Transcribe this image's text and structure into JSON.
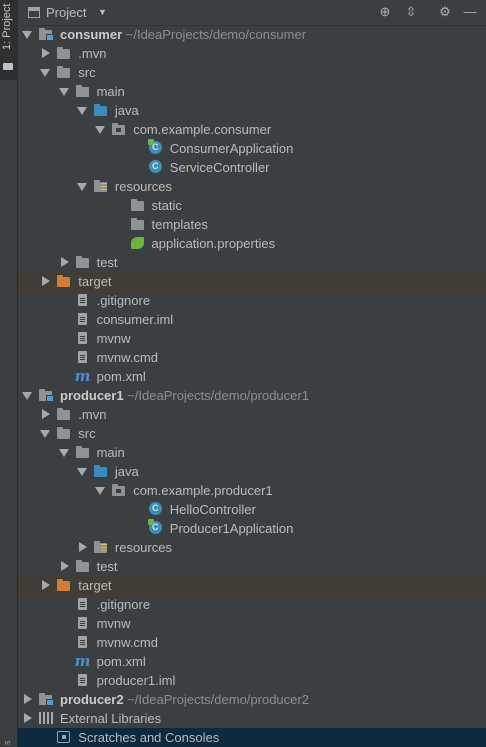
{
  "side_tab": {
    "label": "1: Project",
    "bottom_stub": "s"
  },
  "header": {
    "title": "Project",
    "icons": [
      "locate-icon",
      "collapse-all-icon",
      "gear-icon",
      "minimize-icon"
    ]
  },
  "tree": [
    {
      "label": "consumer",
      "path": "~/IdeaProjects/demo/consumer",
      "icon": "module-folder-icon",
      "expanded": true,
      "depth": 0,
      "bold": true
    },
    {
      "label": ".mvn",
      "icon": "folder-icon",
      "expanded": false,
      "depth": 1
    },
    {
      "label": "src",
      "icon": "folder-icon",
      "expanded": true,
      "depth": 1
    },
    {
      "label": "main",
      "icon": "folder-icon",
      "expanded": true,
      "depth": 2
    },
    {
      "label": "java",
      "icon": "source-folder-icon",
      "expanded": true,
      "depth": 3
    },
    {
      "label": "com.example.consumer",
      "icon": "package-icon",
      "expanded": true,
      "depth": 4
    },
    {
      "label": "ConsumerApplication",
      "icon": "spring-class-icon",
      "depth": 6
    },
    {
      "label": "ServiceController",
      "icon": "class-icon",
      "depth": 6
    },
    {
      "label": "resources",
      "icon": "resources-folder-icon",
      "expanded": true,
      "depth": 3
    },
    {
      "label": "static",
      "icon": "folder-icon",
      "depth": 5
    },
    {
      "label": "templates",
      "icon": "folder-icon",
      "depth": 5
    },
    {
      "label": "application.properties",
      "icon": "spring-properties-icon",
      "depth": 5
    },
    {
      "label": "test",
      "icon": "folder-icon",
      "expanded": false,
      "depth": 2
    },
    {
      "label": "target",
      "icon": "excluded-folder-icon",
      "expanded": false,
      "depth": 1,
      "excluded": true
    },
    {
      "label": ".gitignore",
      "icon": "file-icon",
      "depth": 2
    },
    {
      "label": "consumer.iml",
      "icon": "file-icon",
      "depth": 2
    },
    {
      "label": "mvnw",
      "icon": "file-icon",
      "depth": 2
    },
    {
      "label": "mvnw.cmd",
      "icon": "file-icon",
      "depth": 2
    },
    {
      "label": "pom.xml",
      "icon": "maven-icon",
      "depth": 2
    },
    {
      "label": "producer1",
      "path": "~/IdeaProjects/demo/producer1",
      "icon": "module-folder-icon",
      "expanded": true,
      "depth": 0,
      "bold": true
    },
    {
      "label": ".mvn",
      "icon": "folder-icon",
      "expanded": false,
      "depth": 1
    },
    {
      "label": "src",
      "icon": "folder-icon",
      "expanded": true,
      "depth": 1
    },
    {
      "label": "main",
      "icon": "folder-icon",
      "expanded": true,
      "depth": 2
    },
    {
      "label": "java",
      "icon": "source-folder-icon",
      "expanded": true,
      "depth": 3
    },
    {
      "label": "com.example.producer1",
      "icon": "package-icon",
      "expanded": true,
      "depth": 4
    },
    {
      "label": "HelloController",
      "icon": "class-icon",
      "depth": 6
    },
    {
      "label": "Producer1Application",
      "icon": "spring-class-icon",
      "depth": 6
    },
    {
      "label": "resources",
      "icon": "resources-folder-icon",
      "expanded": false,
      "depth": 3
    },
    {
      "label": "test",
      "icon": "folder-icon",
      "expanded": false,
      "depth": 2
    },
    {
      "label": "target",
      "icon": "excluded-folder-icon",
      "expanded": false,
      "depth": 1,
      "excluded": true
    },
    {
      "label": ".gitignore",
      "icon": "file-icon",
      "depth": 2
    },
    {
      "label": "mvnw",
      "icon": "file-icon",
      "depth": 2
    },
    {
      "label": "mvnw.cmd",
      "icon": "file-icon",
      "depth": 2
    },
    {
      "label": "pom.xml",
      "icon": "maven-icon",
      "depth": 2
    },
    {
      "label": "producer1.iml",
      "icon": "file-icon",
      "depth": 2
    },
    {
      "label": "producer2",
      "path": "~/IdeaProjects/demo/producer2",
      "icon": "module-folder-icon",
      "expanded": false,
      "depth": 0,
      "bold": true
    },
    {
      "label": "External Libraries",
      "icon": "libraries-icon",
      "expanded": false,
      "depth": 0
    },
    {
      "label": "Scratches and Consoles",
      "icon": "scratches-icon",
      "depth": 1,
      "selected": true
    }
  ]
}
